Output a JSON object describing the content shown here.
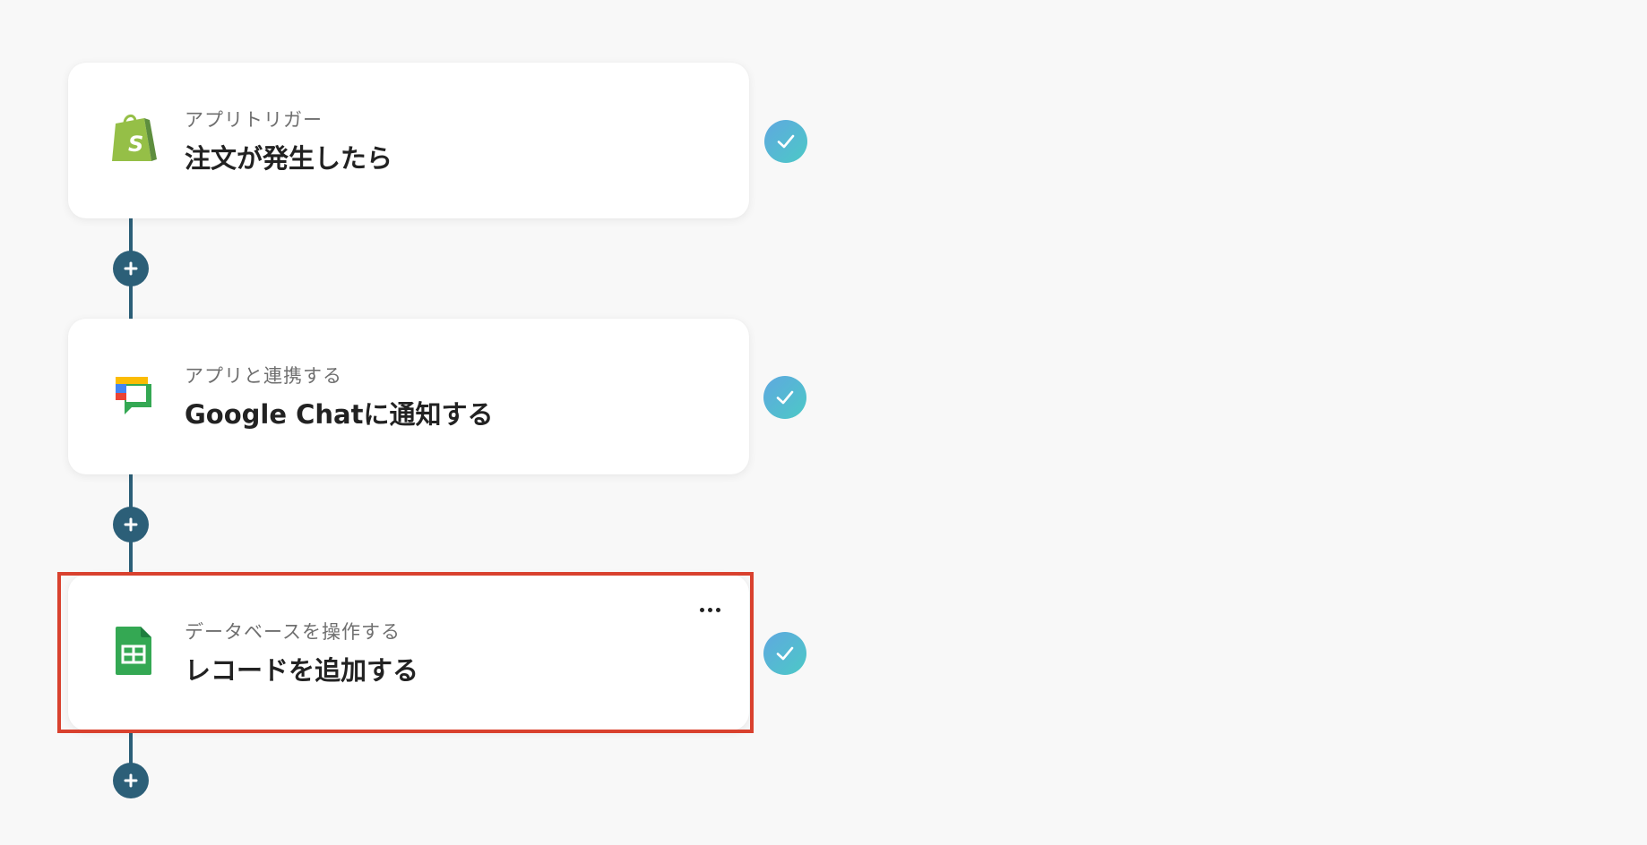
{
  "steps": [
    {
      "subtitle": "アプリトリガー",
      "title": "注文が発生したら",
      "icon": "shopify-icon",
      "status": "completed"
    },
    {
      "subtitle": "アプリと連携する",
      "title": "Google Chatに通知する",
      "icon": "google-chat-icon",
      "status": "completed"
    },
    {
      "subtitle": "データベースを操作する",
      "title": "レコードを追加する",
      "icon": "google-sheets-icon",
      "status": "completed",
      "highlighted": true
    }
  ],
  "colors": {
    "connector": "#2c5f78",
    "highlight": "#d9412e",
    "check_gradient_start": "#5fa8e0",
    "check_gradient_end": "#4cc9c6"
  }
}
